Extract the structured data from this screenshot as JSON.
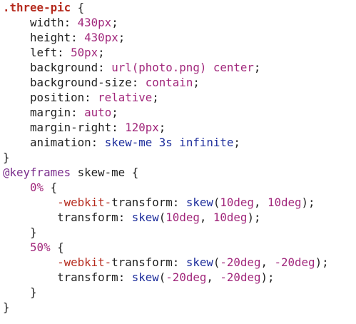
{
  "editor": {
    "lines": [
      [
        {
          "t": ".three-pic",
          "k": "selector"
        },
        {
          "t": " {",
          "k": "punc"
        }
      ],
      [
        {
          "t": "    ",
          "k": "punc"
        },
        {
          "t": "width",
          "k": "prop"
        },
        {
          "t": ": ",
          "k": "punc"
        },
        {
          "t": "430px",
          "k": "value"
        },
        {
          "t": ";",
          "k": "punc"
        }
      ],
      [
        {
          "t": "    ",
          "k": "punc"
        },
        {
          "t": "height",
          "k": "prop"
        },
        {
          "t": ": ",
          "k": "punc"
        },
        {
          "t": "430px",
          "k": "value"
        },
        {
          "t": ";",
          "k": "punc"
        }
      ],
      [
        {
          "t": "    ",
          "k": "punc"
        },
        {
          "t": "left",
          "k": "prop"
        },
        {
          "t": ": ",
          "k": "punc"
        },
        {
          "t": "50px",
          "k": "value"
        },
        {
          "t": ";",
          "k": "punc"
        }
      ],
      [
        {
          "t": "    ",
          "k": "punc"
        },
        {
          "t": "background",
          "k": "prop"
        },
        {
          "t": ": ",
          "k": "punc"
        },
        {
          "t": "url(photo.png) center",
          "k": "value"
        },
        {
          "t": ";",
          "k": "punc"
        }
      ],
      [
        {
          "t": "    ",
          "k": "punc"
        },
        {
          "t": "background-size",
          "k": "prop"
        },
        {
          "t": ": ",
          "k": "punc"
        },
        {
          "t": "contain",
          "k": "value"
        },
        {
          "t": ";",
          "k": "punc"
        }
      ],
      [
        {
          "t": "    ",
          "k": "punc"
        },
        {
          "t": "position",
          "k": "prop"
        },
        {
          "t": ": ",
          "k": "punc"
        },
        {
          "t": "relative",
          "k": "value"
        },
        {
          "t": ";",
          "k": "punc"
        }
      ],
      [
        {
          "t": "    ",
          "k": "punc"
        },
        {
          "t": "margin",
          "k": "prop"
        },
        {
          "t": ": ",
          "k": "punc"
        },
        {
          "t": "auto",
          "k": "value"
        },
        {
          "t": ";",
          "k": "punc"
        }
      ],
      [
        {
          "t": "    ",
          "k": "punc"
        },
        {
          "t": "margin-right",
          "k": "prop"
        },
        {
          "t": ": ",
          "k": "punc"
        },
        {
          "t": "120px",
          "k": "value"
        },
        {
          "t": ";",
          "k": "punc"
        }
      ],
      [
        {
          "t": "    ",
          "k": "punc"
        },
        {
          "t": "animation",
          "k": "prop"
        },
        {
          "t": ": ",
          "k": "punc"
        },
        {
          "t": "skew-me 3s infinite",
          "k": "anim"
        },
        {
          "t": ";",
          "k": "punc"
        }
      ],
      [
        {
          "t": "}",
          "k": "punc"
        }
      ],
      [
        {
          "t": "@keyframes",
          "k": "at"
        },
        {
          "t": " skew-me {",
          "k": "ident"
        }
      ],
      [
        {
          "t": "    ",
          "k": "punc"
        },
        {
          "t": "0%",
          "k": "value"
        },
        {
          "t": " {",
          "k": "punc"
        }
      ],
      [
        {
          "t": "        ",
          "k": "punc"
        },
        {
          "t": "-webkit-",
          "k": "prefix"
        },
        {
          "t": "transform",
          "k": "prop"
        },
        {
          "t": ": ",
          "k": "punc"
        },
        {
          "t": "skew",
          "k": "anim"
        },
        {
          "t": "(",
          "k": "punc"
        },
        {
          "t": "10deg",
          "k": "value"
        },
        {
          "t": ", ",
          "k": "punc"
        },
        {
          "t": "10deg",
          "k": "value"
        },
        {
          "t": ");",
          "k": "punc"
        }
      ],
      [
        {
          "t": "        ",
          "k": "punc"
        },
        {
          "t": "transform",
          "k": "prop"
        },
        {
          "t": ": ",
          "k": "punc"
        },
        {
          "t": "skew",
          "k": "anim"
        },
        {
          "t": "(",
          "k": "punc"
        },
        {
          "t": "10deg",
          "k": "value"
        },
        {
          "t": ", ",
          "k": "punc"
        },
        {
          "t": "10deg",
          "k": "value"
        },
        {
          "t": ");",
          "k": "punc"
        }
      ],
      [
        {
          "t": "    }",
          "k": "punc"
        }
      ],
      [
        {
          "t": "    ",
          "k": "punc"
        },
        {
          "t": "50%",
          "k": "value"
        },
        {
          "t": " {",
          "k": "punc"
        }
      ],
      [
        {
          "t": "        ",
          "k": "punc"
        },
        {
          "t": "-webkit-",
          "k": "prefix"
        },
        {
          "t": "transform",
          "k": "prop"
        },
        {
          "t": ": ",
          "k": "punc"
        },
        {
          "t": "skew",
          "k": "anim"
        },
        {
          "t": "(",
          "k": "punc"
        },
        {
          "t": "-20deg",
          "k": "value"
        },
        {
          "t": ", ",
          "k": "punc"
        },
        {
          "t": "-20deg",
          "k": "value"
        },
        {
          "t": ");",
          "k": "punc"
        }
      ],
      [
        {
          "t": "        ",
          "k": "punc"
        },
        {
          "t": "transform",
          "k": "prop"
        },
        {
          "t": ": ",
          "k": "punc"
        },
        {
          "t": "skew",
          "k": "anim"
        },
        {
          "t": "(",
          "k": "punc"
        },
        {
          "t": "-20deg",
          "k": "value"
        },
        {
          "t": ", ",
          "k": "punc"
        },
        {
          "t": "-20deg",
          "k": "value"
        },
        {
          "t": ");",
          "k": "punc"
        }
      ],
      [
        {
          "t": "    }",
          "k": "punc"
        }
      ],
      [
        {
          "t": "}",
          "k": "punc"
        }
      ]
    ]
  },
  "colors": {
    "selector": "#b52a1d",
    "property": "#1f1f1f",
    "value": "#a1277b",
    "animation": "#1e2e9c",
    "at_rule": "#7a2d8c",
    "background": "#ffffff"
  }
}
